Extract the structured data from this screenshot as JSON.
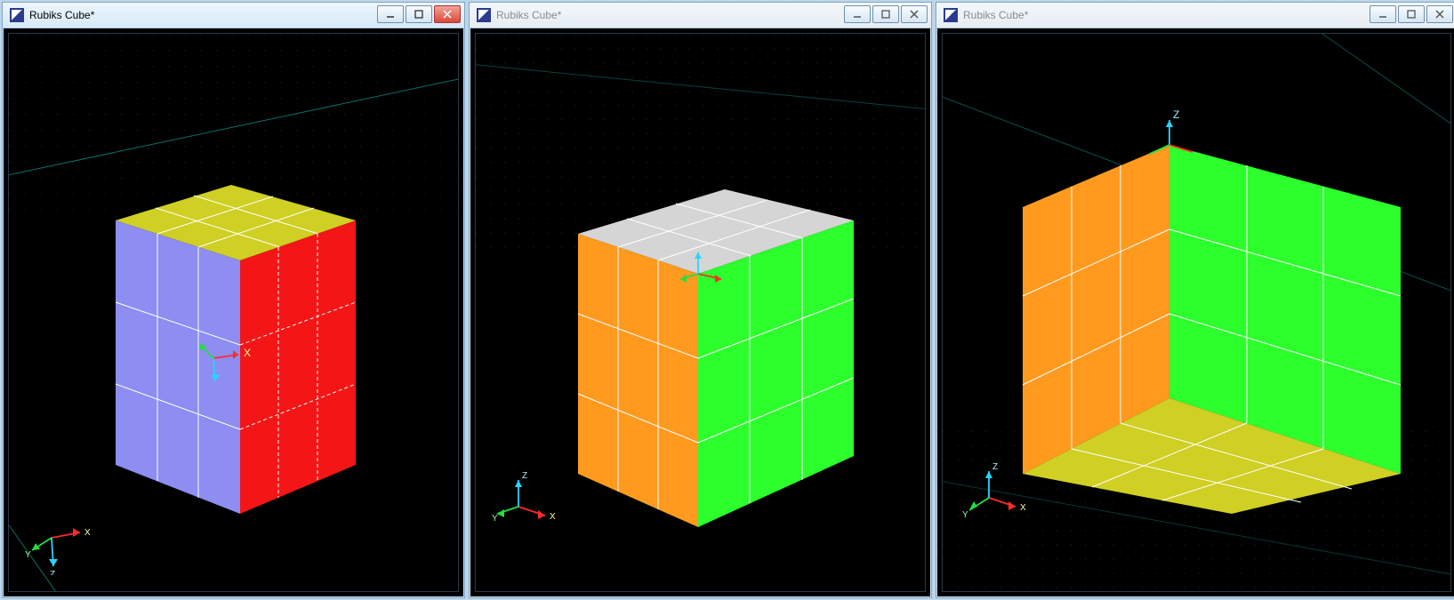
{
  "windows": [
    {
      "title": "Rubiks Cube*",
      "active": true
    },
    {
      "title": "Rubiks Cube*",
      "active": false
    },
    {
      "title": "Rubiks Cube*",
      "active": false
    }
  ],
  "axis": {
    "x": "X",
    "y": "Y",
    "z": "Z"
  },
  "colors": {
    "blue": "#8d8df2",
    "red": "#f41616",
    "yellow": "#cfcf24",
    "orange": "#ff9a1f",
    "green": "#2dff2d",
    "white": "#d5d5d5",
    "teal": "#14e0d0"
  },
  "cubes": [
    {
      "top": "yellow",
      "left": "blue",
      "right": "red"
    },
    {
      "top": "white",
      "left": "orange",
      "right": "green"
    },
    {
      "left": "orange",
      "right": "green",
      "bottom": "yellow"
    }
  ]
}
